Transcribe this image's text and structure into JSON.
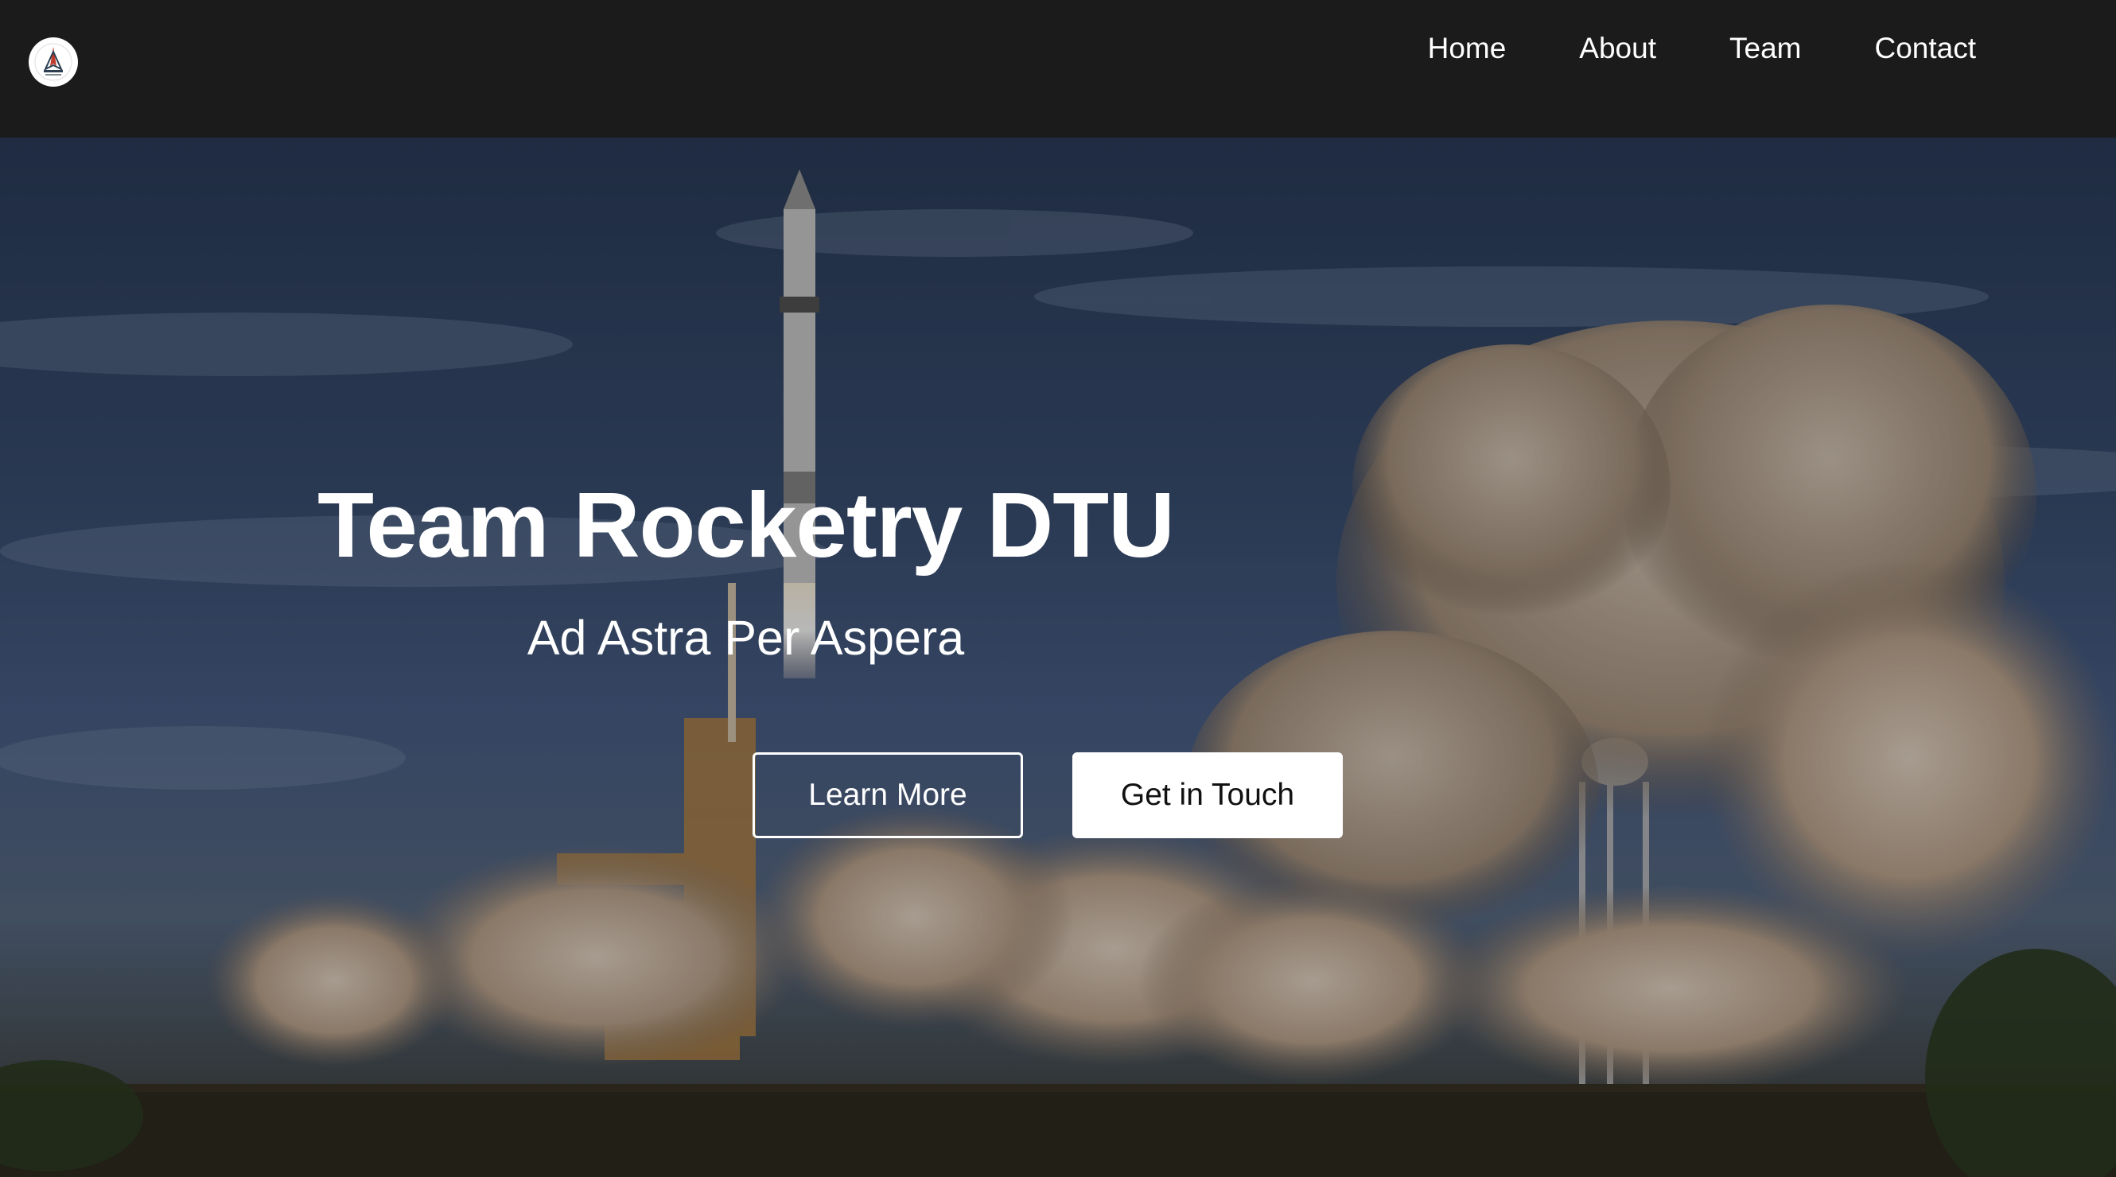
{
  "nav": {
    "logo_icon": "dtu-rocketry-logo-icon",
    "links": [
      {
        "label": "Home"
      },
      {
        "label": "About"
      },
      {
        "label": "Team"
      },
      {
        "label": "Contact"
      }
    ]
  },
  "hero": {
    "title": "Team Rocketry DTU",
    "subtitle": "Ad Astra Per Aspera",
    "buttons": {
      "primary_label": "Learn More",
      "secondary_label": "Get in Touch"
    },
    "background_image": "rocket-launch-photo"
  },
  "colors": {
    "navbar_bg": "#1b1b1b",
    "text": "#ffffff",
    "button_solid_bg": "#ffffff",
    "button_solid_text": "#111111"
  }
}
